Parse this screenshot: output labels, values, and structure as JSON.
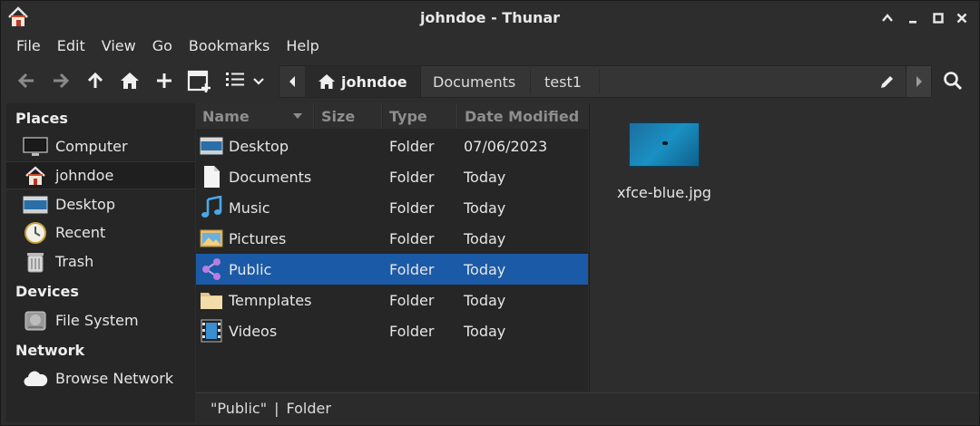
{
  "window": {
    "title": "johndoe - Thunar"
  },
  "menubar": {
    "items": [
      "File",
      "Edit",
      "View",
      "Go",
      "Bookmarks",
      "Help"
    ]
  },
  "pathbar": {
    "crumbs": [
      "johndoe",
      "Documents",
      "test1"
    ]
  },
  "sidebar": {
    "places_heading": "Places",
    "places": [
      {
        "label": "Computer",
        "icon": "computer-icon"
      },
      {
        "label": "johndoe",
        "icon": "home-icon"
      },
      {
        "label": "Desktop",
        "icon": "desktop-icon"
      },
      {
        "label": "Recent",
        "icon": "recent-icon"
      },
      {
        "label": "Trash",
        "icon": "trash-icon"
      }
    ],
    "devices_heading": "Devices",
    "devices": [
      {
        "label": "File System",
        "icon": "drive-icon"
      }
    ],
    "network_heading": "Network",
    "network": [
      {
        "label": "Browse Network",
        "icon": "cloud-icon"
      }
    ]
  },
  "columns": {
    "name": "Name",
    "size": "Size",
    "type": "Type",
    "date": "Date Modified"
  },
  "files": [
    {
      "name": "Desktop",
      "type": "Folder",
      "date": "07/06/2023",
      "icon": "desktop-folder-icon"
    },
    {
      "name": "Documents",
      "type": "Folder",
      "date": "Today",
      "icon": "document-icon"
    },
    {
      "name": "Music",
      "type": "Folder",
      "date": "Today",
      "icon": "music-icon"
    },
    {
      "name": "Pictures",
      "type": "Folder",
      "date": "Today",
      "icon": "pictures-icon"
    },
    {
      "name": "Public",
      "type": "Folder",
      "date": "Today",
      "icon": "share-icon"
    },
    {
      "name": "Temnplates",
      "type": "Folder",
      "date": "Today",
      "icon": "folder-icon"
    },
    {
      "name": "Videos",
      "type": "Folder",
      "date": "Today",
      "icon": "video-icon"
    }
  ],
  "preview": {
    "file_name": "xfce-blue.jpg"
  },
  "statusbar": {
    "selection": "\"Public\"",
    "separator": "|",
    "kind": "Folder"
  },
  "colors": {
    "selection": "#1b5aa6",
    "background": "#2d2d2d",
    "pane": "#262626"
  }
}
